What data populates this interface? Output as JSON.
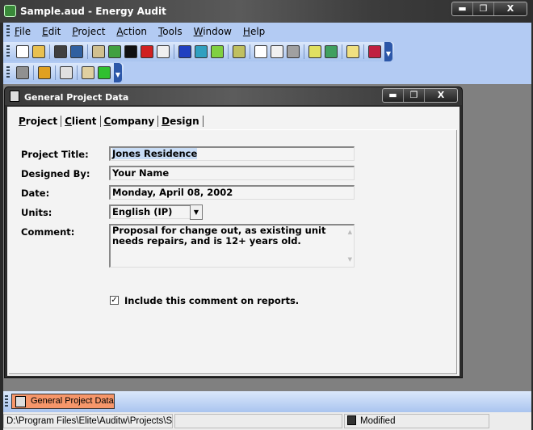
{
  "window": {
    "title": "Sample.aud - Energy Audit",
    "minimize": "▬",
    "maximize": "❐",
    "close": "X"
  },
  "menu": [
    "File",
    "Edit",
    "Project",
    "Action",
    "Tools",
    "Window",
    "Help"
  ],
  "toolbar1": [
    {
      "icon": "new-file-icon",
      "color": "#ffffff"
    },
    {
      "icon": "open-folder-icon",
      "color": "#e8c050"
    },
    "sep",
    {
      "icon": "save-icon",
      "color": "#404040"
    },
    {
      "icon": "save-all-icon",
      "color": "#3060a0"
    },
    "sep",
    {
      "icon": "building-icon",
      "color": "#d0c090"
    },
    {
      "icon": "cost-icon",
      "color": "#40a040"
    },
    {
      "icon": "plug-icon",
      "color": "#111111"
    },
    {
      "icon": "fan-icon",
      "color": "#d02020"
    },
    {
      "icon": "utility-icon",
      "color": "#f0f0f0"
    },
    "sep",
    {
      "icon": "scale-icon",
      "color": "#2040c0"
    },
    {
      "icon": "p-report-icon",
      "color": "#30a0c0"
    },
    {
      "icon": "list-icon",
      "color": "#80d040"
    },
    "sep",
    {
      "icon": "zoom-icon",
      "color": "#c0c060"
    },
    "sep",
    {
      "icon": "page-icon",
      "color": "#ffffff"
    },
    {
      "icon": "print-preview-icon",
      "color": "#f0f0f0"
    },
    {
      "icon": "print-icon",
      "color": "#a0a0a0"
    },
    "sep",
    {
      "icon": "weather-icon",
      "color": "#e0e060"
    },
    {
      "icon": "map-icon",
      "color": "#40a060"
    },
    "sep",
    {
      "icon": "tree-icon",
      "color": "#f0e080"
    },
    "sep",
    {
      "icon": "house-icon",
      "color": "#c02040"
    }
  ],
  "toolbar2": [
    {
      "icon": "house-outline-icon",
      "color": "#909090"
    },
    "sep",
    {
      "icon": "colors-icon",
      "color": "#e0a020"
    },
    "sep",
    {
      "icon": "find-icon",
      "color": "#e0e0e0"
    },
    "sep",
    {
      "icon": "book-icon",
      "color": "#e0d0a0"
    },
    {
      "icon": "help-icon",
      "color": "#30c030"
    }
  ],
  "child": {
    "title": "General Project Data",
    "minimize": "▬",
    "maximize": "❐",
    "close": "X"
  },
  "tabs": [
    "Project",
    "Client",
    "Company",
    "Design"
  ],
  "form": {
    "project_title_label": "Project Title:",
    "project_title": "Jones Residence",
    "designed_by_label": "Designed By:",
    "designed_by": "Your Name",
    "date_label": "Date:",
    "date": "Monday, April 08, 2002",
    "units_label": "Units:",
    "units": "English (IP)",
    "comment_label": "Comment:",
    "comment": "Proposal for change out, as existing unit needs repairs, and is 12+ years old.",
    "include_comment_label": "Include this comment on reports.",
    "include_comment_checked": true
  },
  "taskbar": {
    "item": "General Project Data"
  },
  "status": {
    "path": "D:\\Program Files\\Elite\\Auditw\\Projects\\Sar",
    "middle": "",
    "state": "Modified"
  }
}
